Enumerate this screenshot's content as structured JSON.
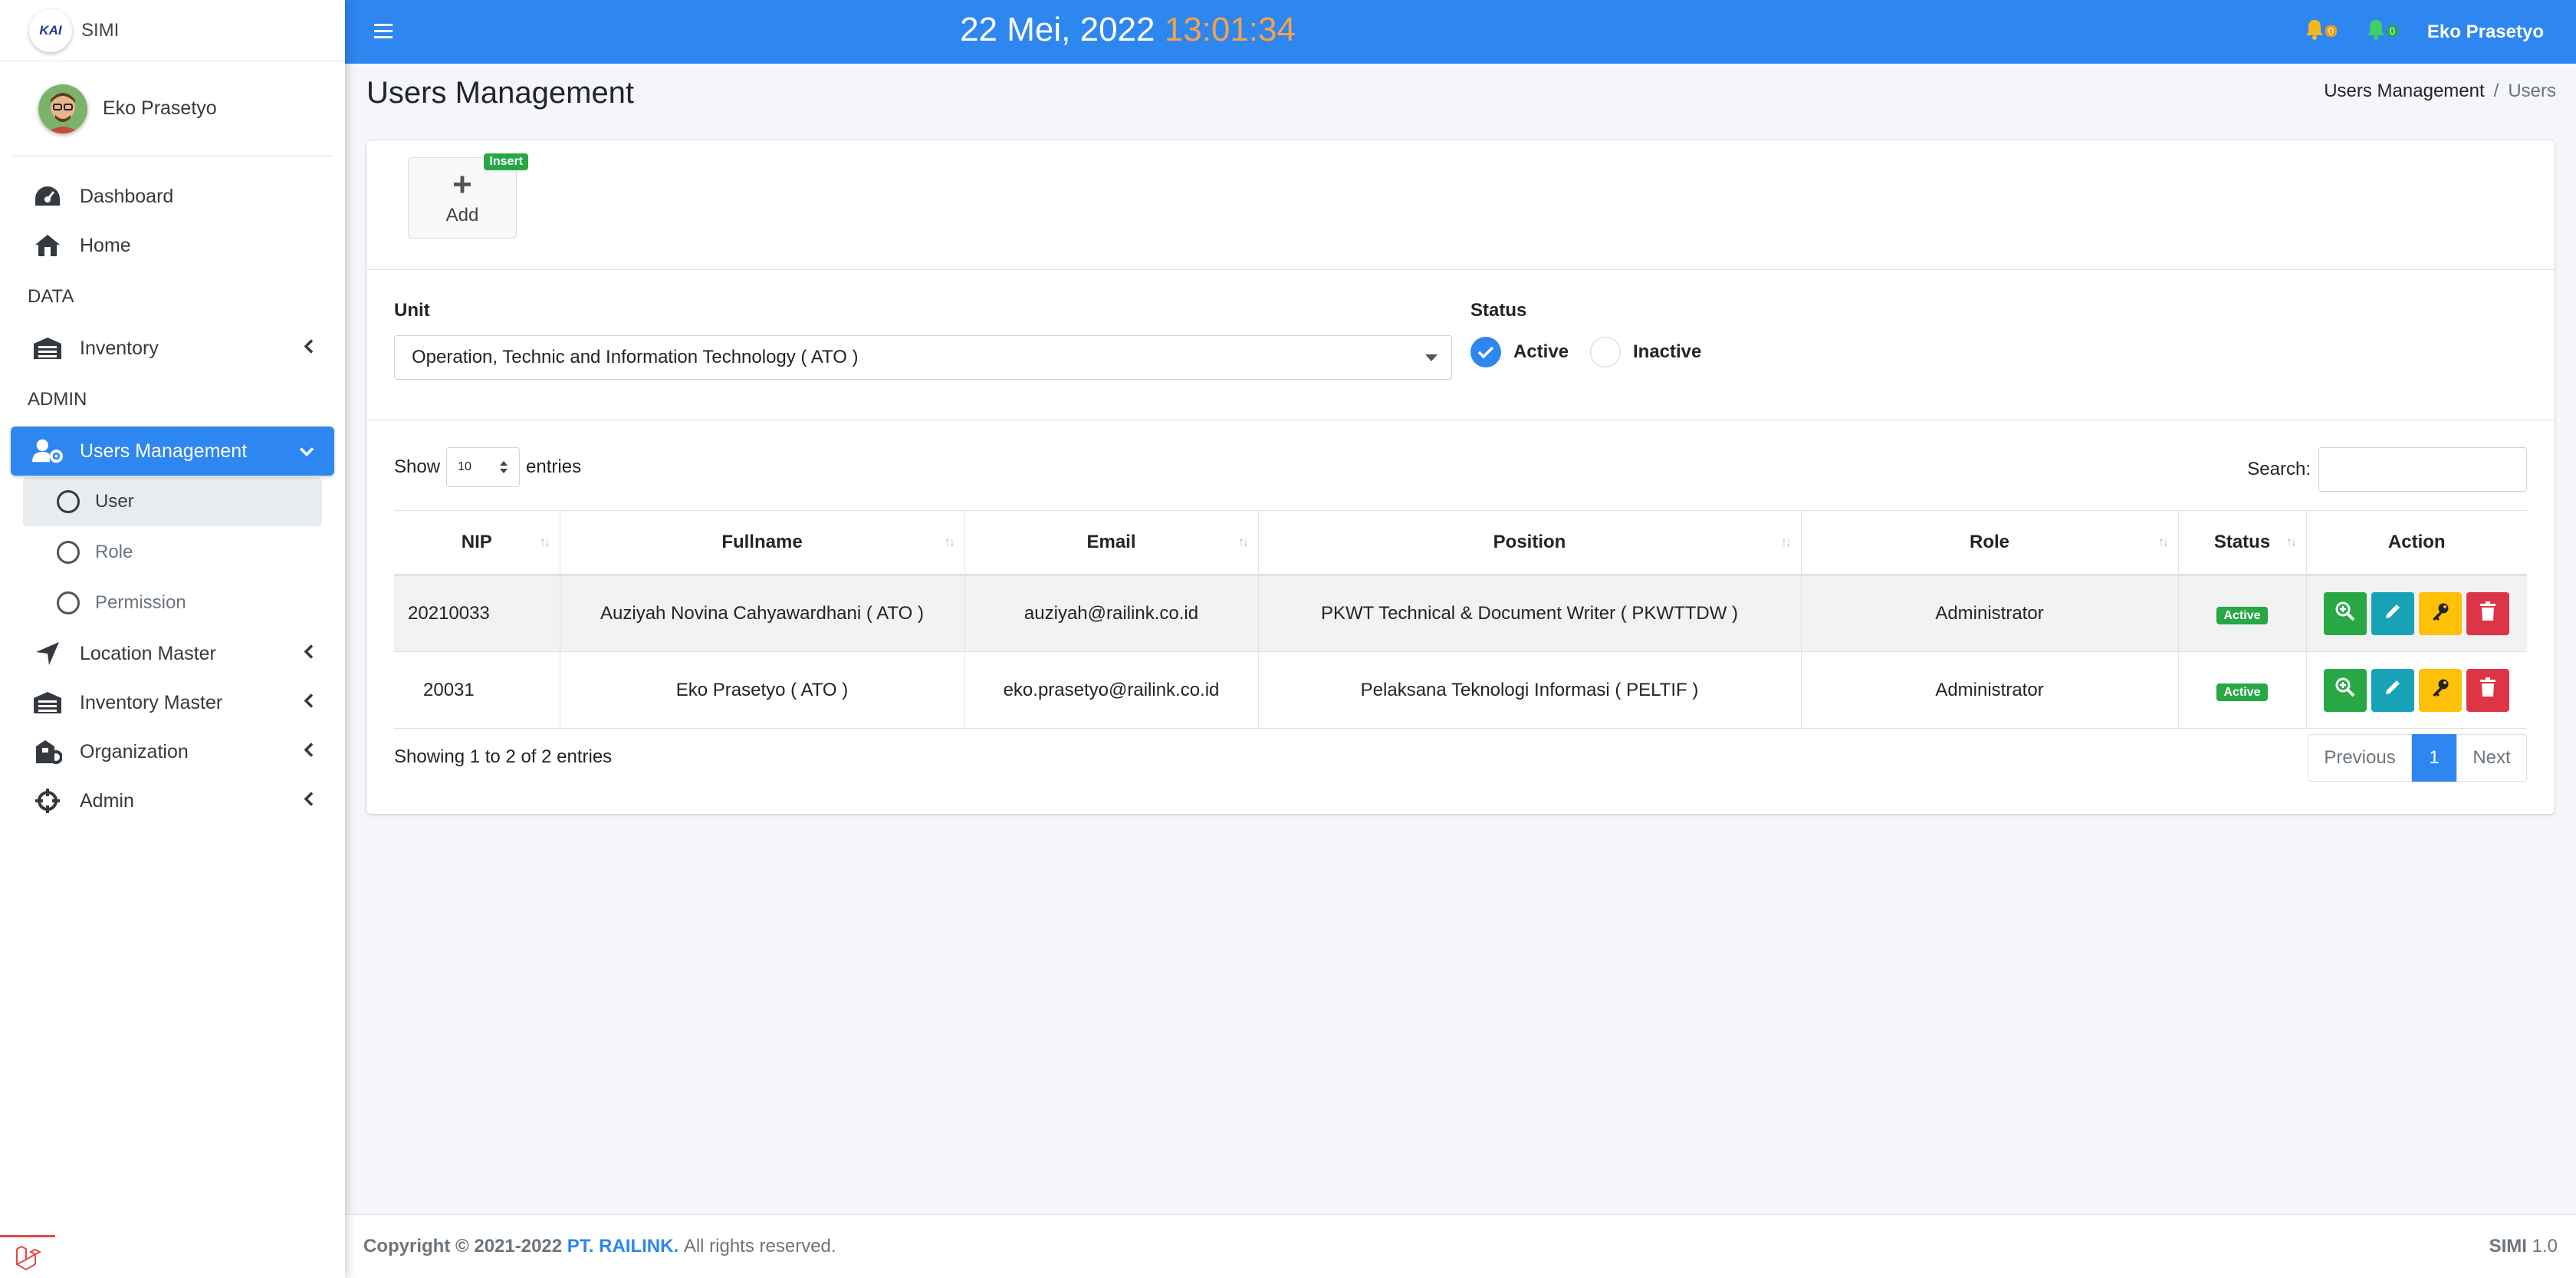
{
  "brand": {
    "logo_text": "KAI",
    "name": "SIMI"
  },
  "user": {
    "name": "Eko Prasetyo"
  },
  "nav": {
    "dashboard": "Dashboard",
    "home": "Home",
    "data_header": "DATA",
    "inventory": "Inventory",
    "admin_header": "ADMIN",
    "users_management": "Users Management",
    "sub": {
      "user": "User",
      "role": "Role",
      "permission": "Permission"
    },
    "location_master": "Location Master",
    "inventory_master": "Inventory Master",
    "organization": "Organization",
    "admin": "Admin"
  },
  "header": {
    "date": "22 Mei, 2022",
    "time": "13:01:34",
    "notif_orange_count": "0",
    "notif_green_count": "0",
    "user": "Eko Prasetyo"
  },
  "page": {
    "title": "Users Management",
    "breadcrumb": {
      "parent": "Users Management",
      "current": "Users"
    }
  },
  "toolbar": {
    "add_label": "Add",
    "add_badge": "Insert"
  },
  "filters": {
    "unit_label": "Unit",
    "unit_value": "Operation, Technic and Information Technology ( ATO )",
    "status_label": "Status",
    "status_active": "Active",
    "status_inactive": "Inactive"
  },
  "datatable": {
    "show_label": "Show",
    "length_value": "10",
    "entries_label": "entries",
    "search_label": "Search:",
    "columns": [
      "NIP",
      "Fullname",
      "Email",
      "Position",
      "Role",
      "Status",
      "Action"
    ],
    "rows": [
      {
        "nip": "20210033",
        "fullname": "Auziyah Novina Cahyawardhani ( ATO )",
        "email": "auziyah@railink.co.id",
        "position": "PKWT Technical & Document Writer ( PKWTTDW )",
        "role": "Administrator",
        "status": "Active"
      },
      {
        "nip": "20031",
        "fullname": "Eko Prasetyo ( ATO )",
        "email": "eko.prasetyo@railink.co.id",
        "position": "Pelaksana Teknologi Informasi ( PELTIF )",
        "role": "Administrator",
        "status": "Active"
      }
    ],
    "info": "Showing 1 to 2 of 2 entries",
    "pagination": {
      "previous": "Previous",
      "page": "1",
      "next": "Next"
    }
  },
  "footer": {
    "copyright": "Copyright © 2021-2022",
    "company": "PT. RAILINK.",
    "rights": "All rights reserved.",
    "app": "SIMI",
    "version": "1.0"
  },
  "colors": {
    "primary": "#2e86f0",
    "time": "#f5a24a",
    "success": "#28a745",
    "info": "#17a2b8",
    "warning": "#ffc107",
    "danger": "#dc3545"
  },
  "icons": [
    "menu-icon",
    "bell-icon",
    "dashboard-icon",
    "home-icon",
    "warehouse-icon",
    "users-cog-icon",
    "location-arrow-icon",
    "building-icon",
    "crosshairs-icon",
    "chevron-left-icon",
    "chevron-down-icon",
    "search-plus-icon",
    "pencil-icon",
    "key-icon",
    "trash-icon",
    "check-icon",
    "laravel-icon"
  ]
}
